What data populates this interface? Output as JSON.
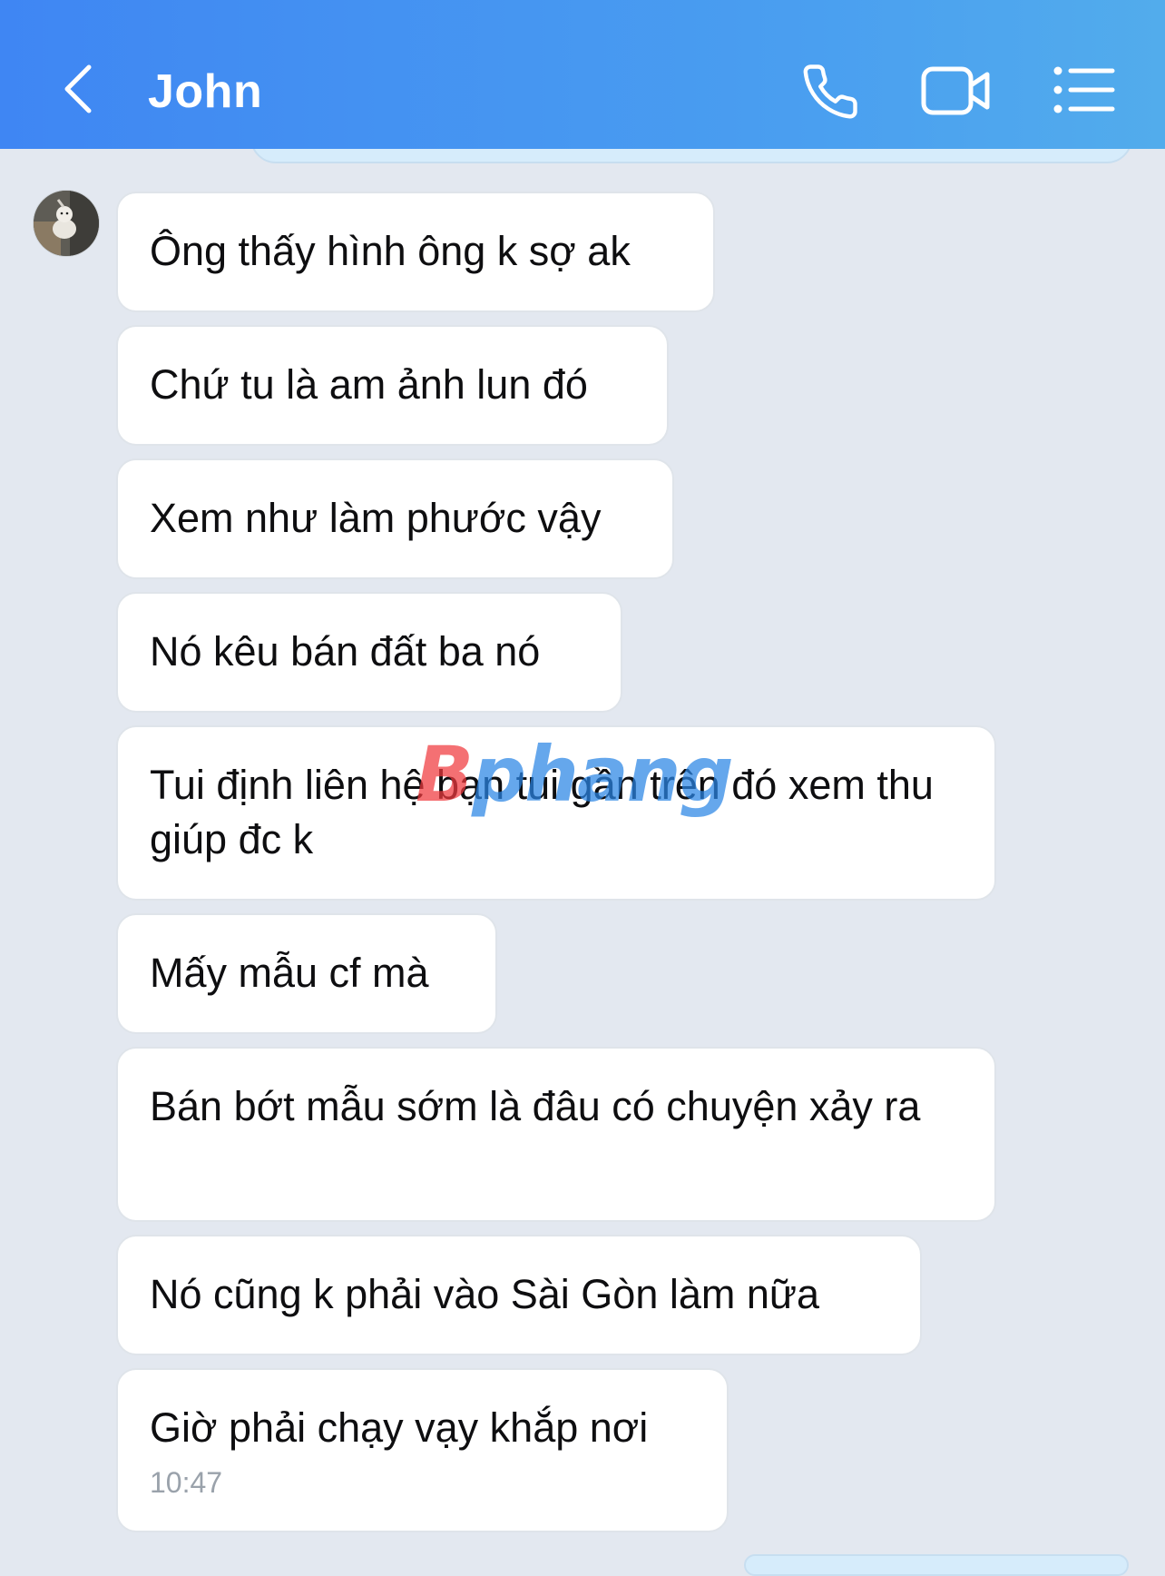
{
  "header": {
    "title": "John",
    "icons": [
      "back-icon",
      "phone-icon",
      "video-camera-icon",
      "menu-list-icon"
    ],
    "gradient_start": "#3f86f3",
    "gradient_end": "#52acec"
  },
  "messages": [
    {
      "text": "Ông thấy hình ông k sợ ak"
    },
    {
      "text": "Chứ tu là am ảnh lun đó"
    },
    {
      "text": "Xem như làm phước vậy"
    },
    {
      "text": "Nó kêu bán đất ba nó"
    },
    {
      "text": "Tui định liên hệ bạn tui gần trên đó xem thu giúp đc k"
    },
    {
      "text": "Mấy mẫu cf mà"
    },
    {
      "text": "Bán bớt mẫu sớm là đâu có chuyện xảy ra"
    },
    {
      "text": "Nó cũng k phải vào Sài Gòn làm nữa"
    },
    {
      "text": "Giờ phải chạy vạy khắp nơi",
      "time": "10:47"
    }
  ],
  "watermark": {
    "part1": "B",
    "part2": "phang"
  },
  "colors": {
    "background": "#e3e8f0",
    "bubble": "#ffffff",
    "own_bubble": "#d6ecfb",
    "text": "#0e0e10",
    "timestamp": "#9aa2ab"
  }
}
